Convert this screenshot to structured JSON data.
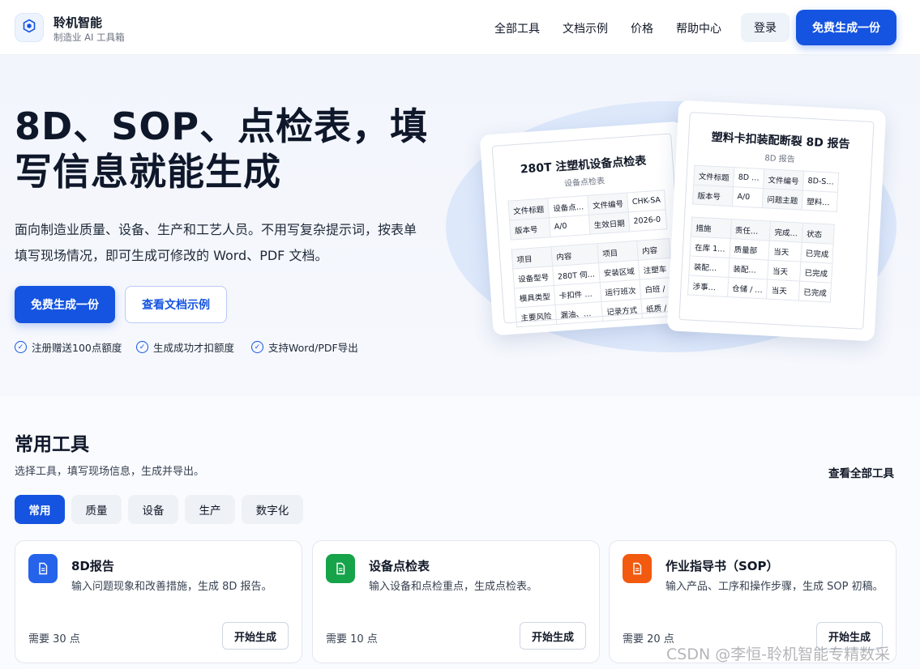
{
  "header": {
    "brand_name": "聆机智能",
    "brand_sub": "制造业 AI 工具箱",
    "nav": [
      "全部工具",
      "文档示例",
      "价格",
      "帮助中心"
    ],
    "login": "登录",
    "cta": "免费生成一份"
  },
  "hero": {
    "title_line1": "8D、SOP、点检表，填",
    "title_line2": "写信息就能生成",
    "desc_line1": "面向制造业质量、设备、生产和工艺人员。不用写复杂提示词，按表单",
    "desc_line2": "填写现场情况，即可生成可修改的 Word、PDF 文档。",
    "primary": "免费生成一份",
    "secondary": "查看文档示例",
    "checks": [
      "注册赠送100点额度",
      "生成成功才扣额度",
      "支持Word/PDF导出"
    ]
  },
  "doc_back": {
    "title": "280T 注塑机设备点检表",
    "sub": "设备点检表",
    "meta": [
      [
        "文件标题",
        "设备点…",
        "文件编号",
        "CHK-SA"
      ],
      [
        "版本号",
        "A/0",
        "生效日期",
        "2026-0"
      ]
    ],
    "rows": [
      [
        "项目",
        "内容",
        "项目",
        "内容"
      ],
      [
        "设备型号",
        "280T 伺…",
        "安装区域",
        "注塑车"
      ],
      [
        "模具类型",
        "卡扣件 …",
        "运行班次",
        "白班 /"
      ],
      [
        "主要风险",
        "漏油、…",
        "记录方式",
        "纸质 /"
      ]
    ]
  },
  "doc_front": {
    "title": "塑料卡扣装配断裂 8D 报告",
    "sub": "8D 报告",
    "meta": [
      [
        "文件标题",
        "8D …",
        "文件编号",
        "8D-S…"
      ],
      [
        "版本号",
        "A/0",
        "问题主题",
        "塑料…"
      ]
    ],
    "rows": [
      [
        "措施",
        "责任…",
        "完成…",
        "状态"
      ],
      [
        "在库 1…",
        "质量部",
        "当天",
        "已完成"
      ],
      [
        "装配…",
        "装配…",
        "当天",
        "已完成"
      ],
      [
        "涉事…",
        "仓储 / …",
        "当天",
        "已完成"
      ]
    ]
  },
  "tools": {
    "title": "常用工具",
    "desc": "选择工具，填写现场信息，生成并导出。",
    "view_all": "查看全部工具",
    "tabs": [
      "常用",
      "质量",
      "设备",
      "生产",
      "数字化"
    ],
    "cards": [
      {
        "name": "8D报告",
        "desc": "输入问题现象和改善措施，生成 8D 报告。",
        "cost": "需要 30 点",
        "button": "开始生成",
        "color": "#2563eb"
      },
      {
        "name": "设备点检表",
        "desc": "输入设备和点检重点，生成点检表。",
        "cost": "需要 10 点",
        "button": "开始生成",
        "color": "#16a34a"
      },
      {
        "name": "作业指导书（SOP）",
        "desc": "输入产品、工序和操作步骤，生成 SOP 初稿。",
        "cost": "需要 20 点",
        "button": "开始生成",
        "color": "#f25a0f"
      }
    ]
  },
  "watermark": "CSDN @李恒-聆机智能专精数采"
}
